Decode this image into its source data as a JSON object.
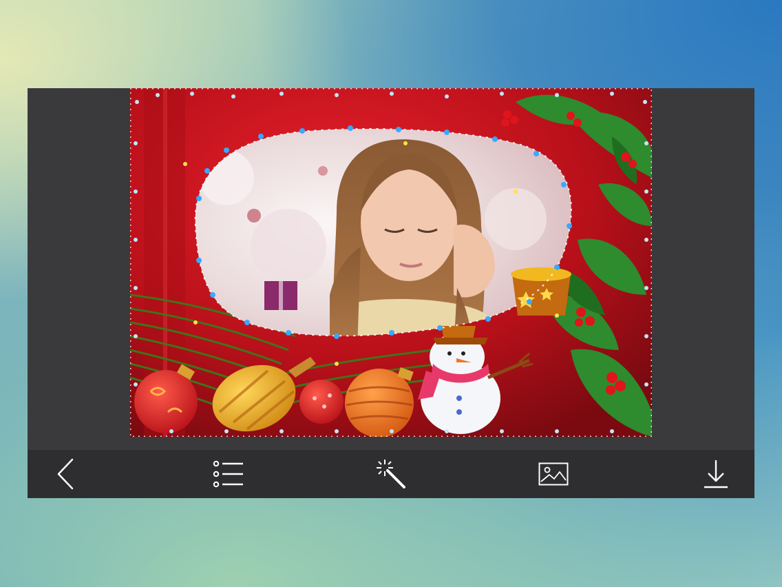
{
  "photo": {
    "subject": "girl-portrait",
    "frame_theme": "christmas-frame"
  },
  "toolbar": {
    "items": [
      {
        "name": "back-button",
        "icon": "chevron-left-icon"
      },
      {
        "name": "frame-list-button",
        "icon": "list-icon"
      },
      {
        "name": "effects-button",
        "icon": "magic-wand-icon"
      },
      {
        "name": "gallery-button",
        "icon": "image-icon"
      },
      {
        "name": "save-button",
        "icon": "download-icon"
      }
    ]
  },
  "colors": {
    "toolbar_bg": "#2e2e30",
    "panel_bg": "#3a3a3c",
    "icon_color": "#ffffff",
    "frame_red": "#c9141c",
    "holly_green": "#2e8b2e"
  }
}
